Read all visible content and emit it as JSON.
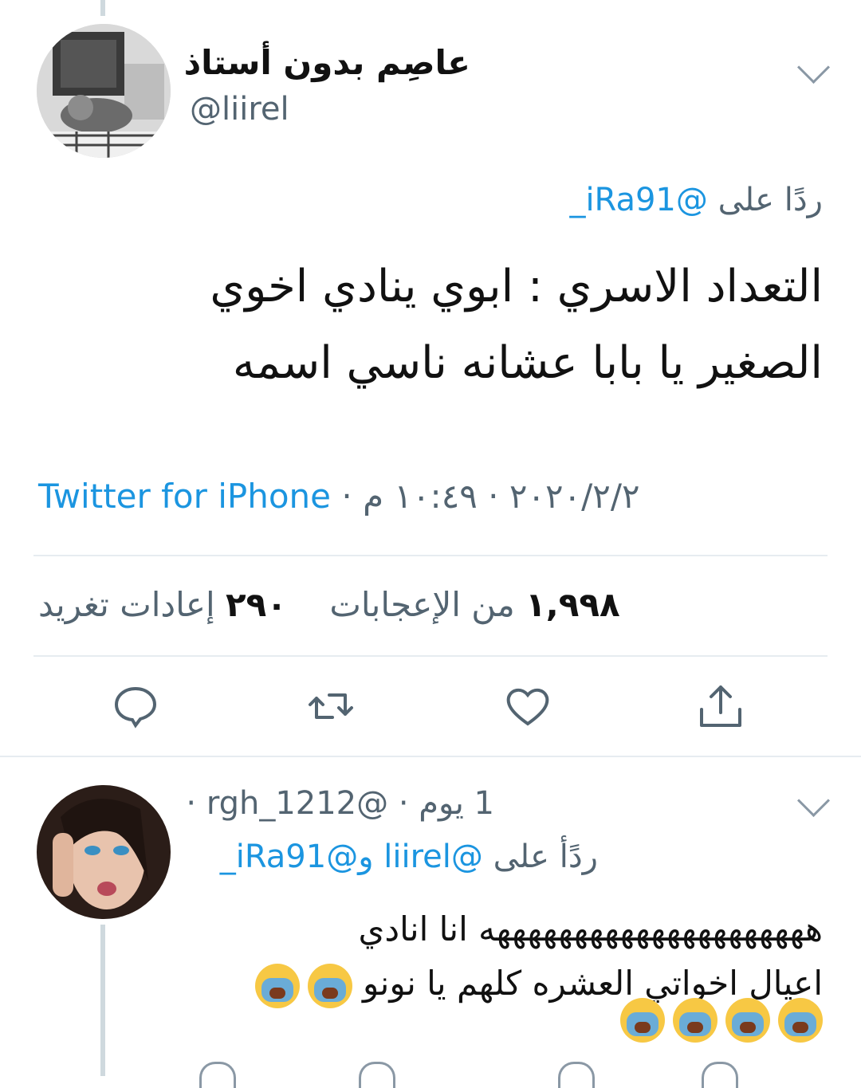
{
  "tweet": {
    "author_name": "عاصِم بدون أستاذ",
    "author_handle": "@liirel",
    "reply_prefix": "ردًا على",
    "reply_to": "@iRa91_",
    "text_line1": "التعداد الاسري : ابوي ينادي اخوي",
    "text_line2": "الصغير يا بابا عشانه ناسي اسمه",
    "time": "١٠:٤٩ م",
    "date": "٢٠٢٠/٢/٢",
    "source": "Twitter for iPhone",
    "retweets_count": "٢٩٠",
    "retweets_label": "إعادات تغريد",
    "likes_count": "١,٩٩٨",
    "likes_label": "من الإعجابات"
  },
  "reply": {
    "handle": "@rgh_1212",
    "age": "1 يوم",
    "reply_prefix": "ردًأ على",
    "reply_to_1": "@liirel",
    "reply_conj": "و",
    "reply_to_2": "@iRa91_",
    "text_line1": "هههههههههههههههههههههه انا انادي",
    "text_line2": "اعيال اخواتي العشره كلهم يا نونو"
  },
  "icons": {
    "reply": "comment-icon",
    "retweet": "retweet-icon",
    "like": "heart-icon",
    "share": "share-icon",
    "more": "chevron-down-icon",
    "emoji": "loudly-crying-face-emoji"
  },
  "colors": {
    "link": "#1b95e0",
    "secondary": "#536471",
    "divider": "#e6ecf0"
  }
}
